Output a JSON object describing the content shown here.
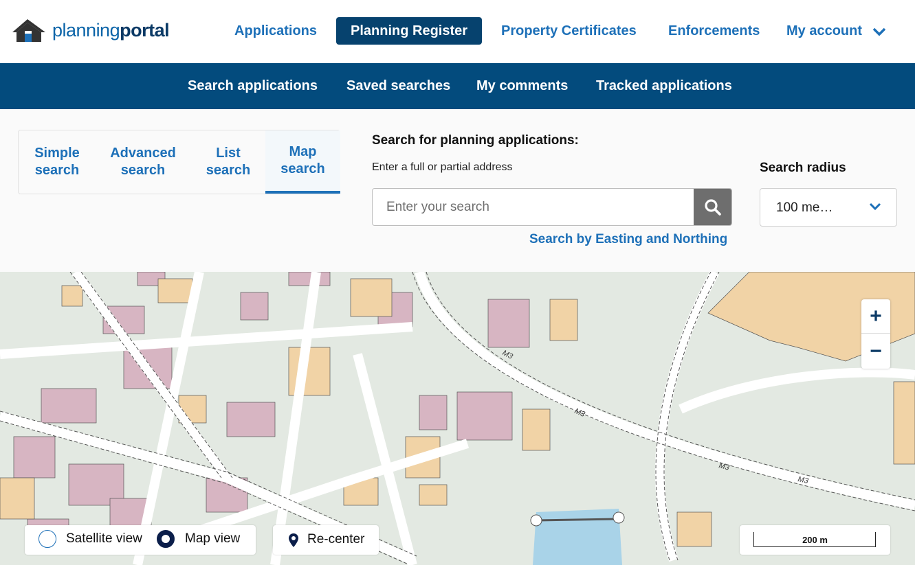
{
  "header": {
    "logo_text_light": "planning",
    "logo_text_bold": "portal",
    "nav": [
      {
        "label": "Applications"
      },
      {
        "label": "Planning Register"
      },
      {
        "label": "Property Certificates"
      },
      {
        "label": "Enforcements"
      },
      {
        "label": "My account"
      }
    ],
    "active_index": 1
  },
  "subnav": [
    {
      "label": "Search applications"
    },
    {
      "label": "Saved searches"
    },
    {
      "label": "My comments"
    },
    {
      "label": "Tracked applications"
    }
  ],
  "search_tabs": [
    {
      "line1": "Simple",
      "line2": "search"
    },
    {
      "line1": "Advanced",
      "line2": "search"
    },
    {
      "line1": "List",
      "line2": "search"
    },
    {
      "line1": "Map",
      "line2": "search"
    }
  ],
  "search": {
    "title": "Search for planning applications:",
    "hint": "Enter a full or partial address",
    "placeholder": "Enter your search",
    "value": "",
    "easting_link": "Search by Easting and Northing",
    "radius_label": "Search radius",
    "radius_value": "100 me…"
  },
  "map": {
    "zoom_in": "+",
    "zoom_out": "−",
    "view_satellite": "Satellite view",
    "view_map": "Map view",
    "selected_view": "Map view",
    "recenter": "Re-center",
    "scale": "200 m",
    "road_label": "M3"
  },
  "colors": {
    "brand_dark": "#034b7d",
    "link": "#1d70b8",
    "building_pink": "#d7b5c2",
    "building_tan": "#f1d3a6",
    "ground": "#e3e9e2",
    "water": "#a9d3e8"
  }
}
